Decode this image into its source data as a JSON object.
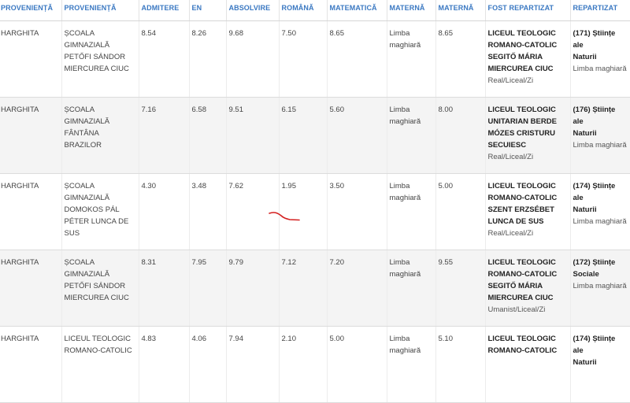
{
  "headers": [
    "PROVENIENȚĂ",
    "PROVENIENȚĂ",
    "ADMITERE",
    "EN",
    "ABSOLVIRE",
    "ROMÂNĂ",
    "MATEMATICĂ",
    "MATERNĂ",
    "MATERNĂ",
    "FOST REPARTIZAT",
    "REPARTIZAT"
  ],
  "rows": [
    {
      "county": "HARGHITA",
      "school_lines": [
        "ȘCOALA",
        "GIMNAZIALĂ",
        "PETŐFI SÁNDOR",
        "MIERCUREA CIUC"
      ],
      "admitere": "8.54",
      "en": "8.26",
      "absolvire": "9.68",
      "romana": "7.50",
      "matematica": "8.65",
      "materna_lines": [
        "Limba",
        "maghiară"
      ],
      "materna_nota": "8.65",
      "fost_lines": [
        "LICEUL TEOLOGIC",
        "ROMANO-CATOLIC",
        "SEGITŐ MÁRIA",
        "MIERCUREA CIUC"
      ],
      "fost_profile": "Real/Liceal/Zi",
      "rep_lines": [
        "(171) Științe ale",
        "Naturii"
      ],
      "rep_lang": "Limba maghiară"
    },
    {
      "county": "HARGHITA",
      "school_lines": [
        "ȘCOALA",
        "GIMNAZIALĂ",
        "FÂNTÂNA",
        "BRAZILOR"
      ],
      "admitere": "7.16",
      "en": "6.58",
      "absolvire": "9.51",
      "romana": "6.15",
      "matematica": "5.60",
      "materna_lines": [
        "Limba",
        "maghiară"
      ],
      "materna_nota": "8.00",
      "fost_lines": [
        "LICEUL TEOLOGIC",
        "UNITARIAN BERDE",
        "MÓZES CRISTURU",
        "SECUIESC"
      ],
      "fost_profile": "Real/Liceal/Zi",
      "rep_lines": [
        "(176) Științe ale",
        "Naturii"
      ],
      "rep_lang": "Limba maghiară"
    },
    {
      "county": "HARGHITA",
      "school_lines": [
        "ȘCOALA",
        "GIMNAZIALĂ",
        "DOMOKOS PÁL",
        "PÉTER LUNCA DE",
        "SUS"
      ],
      "admitere": "4.30",
      "en": "3.48",
      "absolvire": "7.62",
      "romana": "1.95",
      "matematica": "3.50",
      "materna_lines": [
        "Limba",
        "maghiară"
      ],
      "materna_nota": "5.00",
      "fost_lines": [
        "LICEUL TEOLOGIC",
        "ROMANO-CATOLIC",
        "SZENT ERZSÉBET",
        "LUNCA DE SUS"
      ],
      "fost_profile": "Real/Liceal/Zi",
      "rep_lines": [
        "(174) Științe ale",
        "Naturii"
      ],
      "rep_lang": "Limba maghiară"
    },
    {
      "county": "HARGHITA",
      "school_lines": [
        "ȘCOALA",
        "GIMNAZIALĂ",
        "PETŐFI SÁNDOR",
        "MIERCUREA CIUC"
      ],
      "admitere": "8.31",
      "en": "7.95",
      "absolvire": "9.79",
      "romana": "7.12",
      "matematica": "7.20",
      "materna_lines": [
        "Limba",
        "maghiară"
      ],
      "materna_nota": "9.55",
      "fost_lines": [
        "LICEUL TEOLOGIC",
        "ROMANO-CATOLIC",
        "SEGITŐ MÁRIA",
        "MIERCUREA CIUC"
      ],
      "fost_profile": "Umanist/Liceal/Zi",
      "rep_lines": [
        "(172) Științe",
        "Sociale"
      ],
      "rep_lang": "Limba maghiară"
    },
    {
      "county": "HARGHITA",
      "school_lines": [
        "LICEUL TEOLOGIC",
        "ROMANO-CATOLIC"
      ],
      "admitere": "4.83",
      "en": "4.06",
      "absolvire": "7.94",
      "romana": "2.10",
      "matematica": "5.00",
      "materna_lines": [
        "Limba",
        "maghiară"
      ],
      "materna_nota": "5.10",
      "fost_lines": [
        "LICEUL TEOLOGIC",
        "ROMANO-CATOLIC"
      ],
      "fost_profile": "",
      "rep_lines": [
        "(174) Științe ale",
        "Naturii"
      ],
      "rep_lang": ""
    }
  ],
  "colors": {
    "header_text": "#3a78c2",
    "alt_row": "#f4f4f4",
    "pen_mark": "#d42020"
  }
}
